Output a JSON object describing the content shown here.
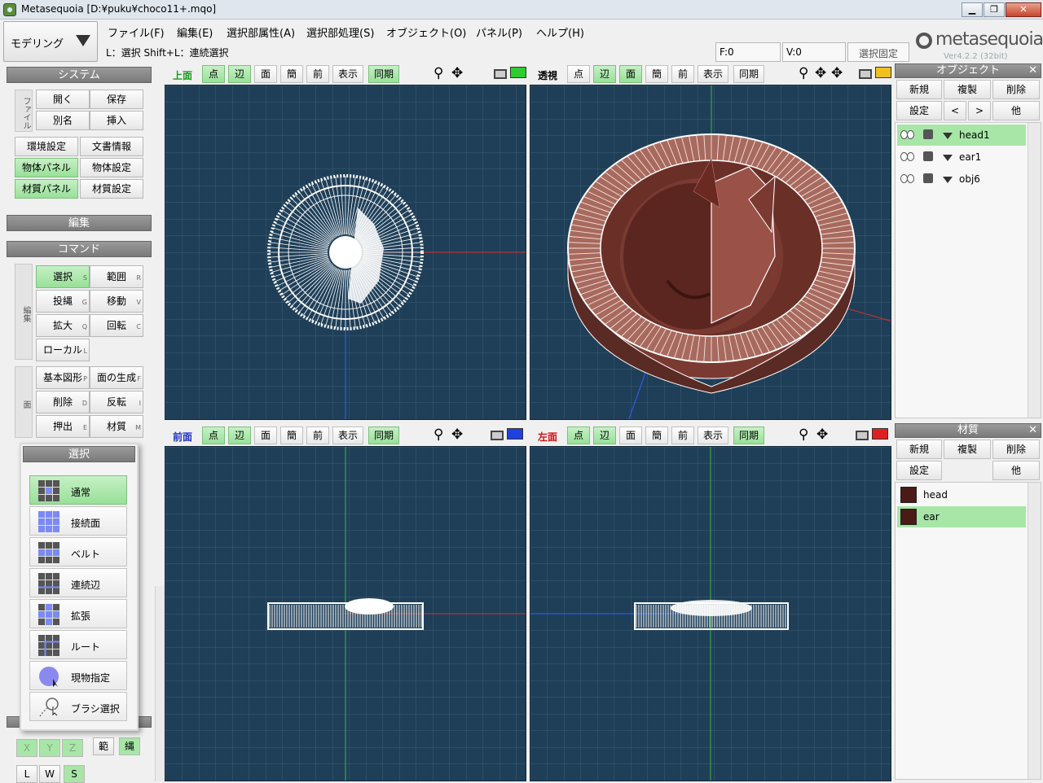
{
  "window": {
    "title": "Metasequoia [D:¥puku¥choco11+.mqo]"
  },
  "mode": {
    "label": "モデリング"
  },
  "menu": [
    "ファイル(F)",
    "編集(E)",
    "選択部属性(A)",
    "選択部処理(S)",
    "オブジェクト(O)",
    "パネル(P)",
    "ヘルプ(H)"
  ],
  "status": {
    "hint": "L：選択  Shift+L：連続選択",
    "faces": "F:0",
    "verts": "V:0",
    "lock": "選択固定"
  },
  "logo": {
    "name": "metasequoia4",
    "version": "Ver4.2.2 (32bit)"
  },
  "left": {
    "system_title": "システム",
    "file_label": "ファイル",
    "open": "開く",
    "save": "保存",
    "alias": "別名",
    "insert": "挿入",
    "env": "環境設定",
    "docinfo": "文書情報",
    "objpanel": "物体パネル",
    "objset": "物体設定",
    "matpanel": "材質パネル",
    "matset": "材質設定",
    "edit_title": "編集",
    "command_title": "コマンド",
    "edit_label": "編集",
    "select": "選択",
    "range": "範囲",
    "project": "投縄",
    "move": "移動",
    "scale": "拡大",
    "rotate": "回転",
    "local": "ローカル",
    "face_label": "面",
    "prim": "基本図形",
    "makeface": "面の生成",
    "delete": "削除",
    "mirror": "反転",
    "extrude": "押出",
    "material": "材質",
    "keys": {
      "select": "S",
      "range": "R",
      "project": "G",
      "move": "V",
      "scale": "Q",
      "rotate": "C",
      "local": "L",
      "prim": "P",
      "makeface": "F",
      "delete": "D",
      "mirror": "I",
      "extrude": "E",
      "material": "M"
    },
    "axes": [
      "X",
      "Y",
      "Z"
    ],
    "range2": "範",
    "rope": "縄",
    "bottom": [
      "L",
      "W",
      "S"
    ]
  },
  "popup": {
    "title": "選択",
    "items": [
      "通常",
      "接続面",
      "ベルト",
      "連続辺",
      "拡張",
      "ルート",
      "現物指定",
      "ブラシ選択"
    ]
  },
  "viewports": [
    {
      "title": "上面",
      "title_color": "#1a9a1a",
      "buttons": [
        "点",
        "辺",
        "面",
        "簡",
        "前",
        "表示",
        "同期"
      ],
      "monitor_color": "#2ecc2e"
    },
    {
      "title": "透視",
      "title_color": "#000000",
      "buttons": [
        "点",
        "辺",
        "面",
        "簡",
        "前",
        "表示",
        "同期"
      ],
      "monitor_color": "#f0c020"
    },
    {
      "title": "前面",
      "title_color": "#2030c0",
      "buttons": [
        "点",
        "辺",
        "面",
        "簡",
        "前",
        "表示",
        "同期"
      ],
      "monitor_color": "#2040e0"
    },
    {
      "title": "左面",
      "title_color": "#d01010",
      "buttons": [
        "点",
        "辺",
        "面",
        "簡",
        "前",
        "表示",
        "同期"
      ],
      "monitor_color": "#e02020"
    }
  ],
  "objects": {
    "title": "オブジェクト",
    "btn_new": "新規",
    "btn_dup": "複製",
    "btn_del": "削除",
    "btn_set": "設定",
    "btn_prev": "<",
    "btn_next": ">",
    "btn_other": "他",
    "items": [
      "head1",
      "ear1",
      "obj6"
    ],
    "selected": "head1"
  },
  "materials": {
    "title": "材質",
    "btn_new": "新規",
    "btn_dup": "複製",
    "btn_del": "削除",
    "btn_set": "設定",
    "btn_other": "他",
    "items": [
      {
        "name": "head",
        "color": "#4a1a16"
      },
      {
        "name": "ear",
        "color": "#4a1a16"
      }
    ],
    "selected": "ear"
  }
}
